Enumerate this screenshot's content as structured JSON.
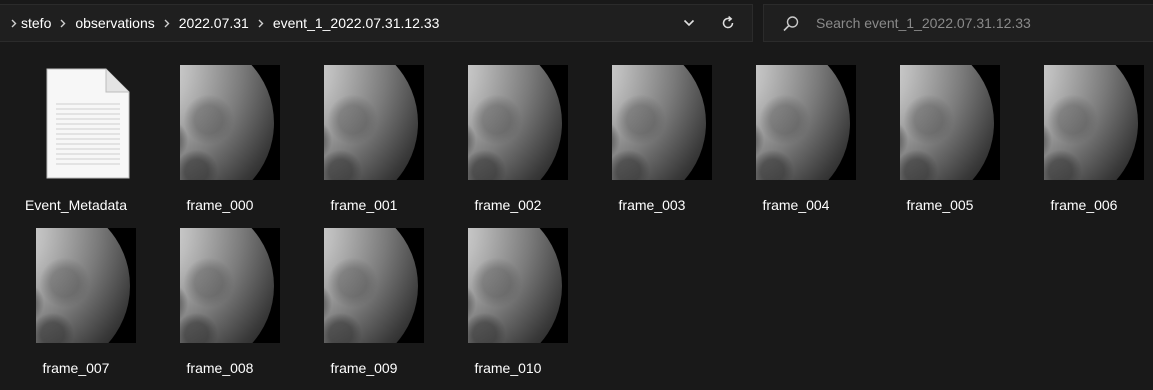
{
  "address_bar": {
    "breadcrumbs": [
      "stefo",
      "observations",
      "2022.07.31",
      "event_1_2022.07.31.12.33"
    ],
    "dropdown_icon": "chevron-down-icon",
    "refresh_icon": "refresh-icon"
  },
  "search": {
    "placeholder": "Search event_1_2022.07.31.12.33",
    "value": "",
    "icon": "search-icon"
  },
  "files": [
    {
      "name": "Event_Metadata",
      "kind": "document"
    },
    {
      "name": "frame_000",
      "kind": "image"
    },
    {
      "name": "frame_001",
      "kind": "image"
    },
    {
      "name": "frame_002",
      "kind": "image"
    },
    {
      "name": "frame_003",
      "kind": "image"
    },
    {
      "name": "frame_004",
      "kind": "image"
    },
    {
      "name": "frame_005",
      "kind": "image"
    },
    {
      "name": "frame_006",
      "kind": "image"
    },
    {
      "name": "frame_007",
      "kind": "image"
    },
    {
      "name": "frame_008",
      "kind": "image"
    },
    {
      "name": "frame_009",
      "kind": "image"
    },
    {
      "name": "frame_010",
      "kind": "image"
    }
  ],
  "colors": {
    "background": "#191919",
    "bar_background": "#1f1f1f",
    "text": "#ffffff",
    "placeholder": "#8a8a8a"
  }
}
